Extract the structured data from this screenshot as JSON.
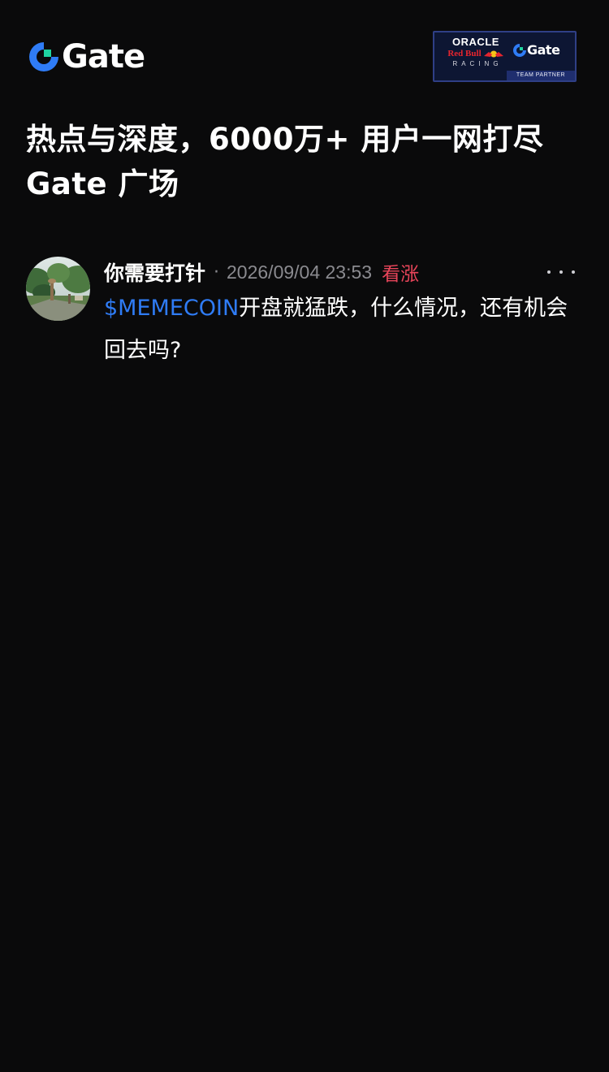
{
  "brand": {
    "logo_text": "Gate",
    "logo_icon": "gate-logo-icon",
    "accent_color": "#2f7cf6",
    "logo_green": "#1fd3a0"
  },
  "partner_badge": {
    "oracle": "ORACLE",
    "redbull": "Red Bull",
    "racing": "RACING",
    "gate": "Gate",
    "team_partner": "TEAM PARTNER"
  },
  "hero": {
    "title_line1": "热点与深度，6000万+ 用户一网打尽",
    "title_line2": "Gate 广场"
  },
  "post": {
    "username": "你需要打针",
    "separator": "·",
    "timestamp": "2026/09/04 23:53",
    "sentiment": "看涨",
    "sentiment_color": "#e8455a",
    "more_icon": "more-horizontal-icon",
    "ticker": "$MEMECOIN",
    "body": "开盘就猛跌，什么情况，还有机会回去吗?"
  }
}
